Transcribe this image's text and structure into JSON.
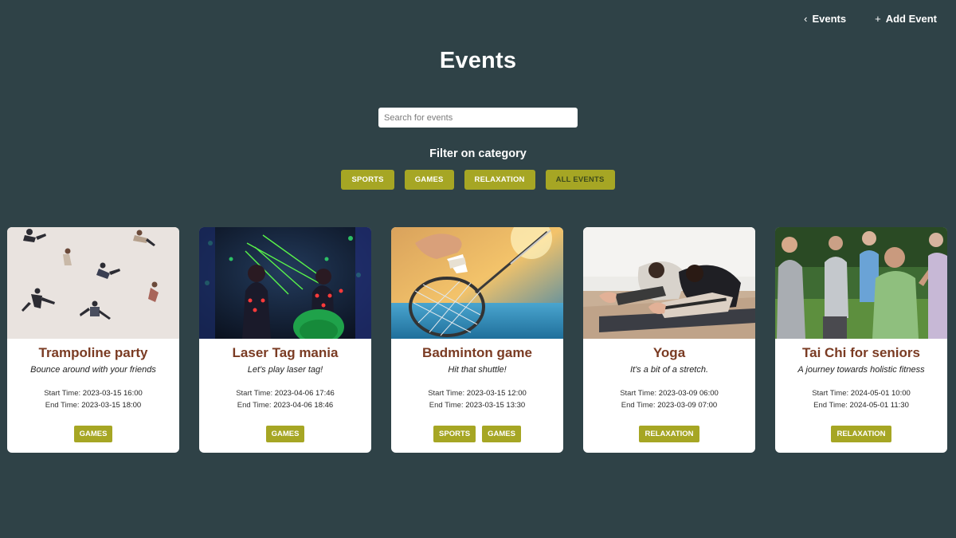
{
  "nav": {
    "back_label": "Events",
    "add_label": "Add Event"
  },
  "page": {
    "title": "Events"
  },
  "search": {
    "placeholder": "Search for events",
    "value": ""
  },
  "filter": {
    "title": "Filter on category",
    "buttons": [
      "SPORTS",
      "GAMES",
      "RELAXATION",
      "ALL EVENTS"
    ],
    "active": "ALL EVENTS"
  },
  "colors": {
    "background": "#2f4247",
    "accent": "#a6a624",
    "title_brown": "#7a3b23"
  },
  "labels": {
    "start": "Start Time:",
    "end": "End Time:"
  },
  "events": [
    {
      "title": "Trampoline party",
      "description": "Bounce around with your friends",
      "start": "2023-03-15 16:00",
      "end": "2023-03-15 18:00",
      "categories": [
        "GAMES"
      ],
      "image": "people jumping in the air"
    },
    {
      "title": "Laser Tag mania",
      "description": "Let's play laser tag!",
      "start": "2023-04-06 17:46",
      "end": "2023-04-06 18:46",
      "categories": [
        "GAMES"
      ],
      "image": "laser tag players in dark arena"
    },
    {
      "title": "Badminton game",
      "description": "Hit that shuttle!",
      "start": "2023-03-15 12:00",
      "end": "2023-03-15 13:30",
      "categories": [
        "SPORTS",
        "GAMES"
      ],
      "image": "hand holding badminton racket and shuttlecock"
    },
    {
      "title": "Yoga",
      "description": "It's a bit of a stretch.",
      "start": "2023-03-09 06:00",
      "end": "2023-03-09 07:00",
      "categories": [
        "RELAXATION"
      ],
      "image": "two people stretching on yoga mats"
    },
    {
      "title": "Tai Chi for seniors",
      "description": "A journey towards holistic fitness",
      "start": "2024-05-01 10:00",
      "end": "2024-05-01 11:30",
      "categories": [
        "RELAXATION"
      ],
      "image": "seniors doing tai chi outdoors"
    }
  ]
}
